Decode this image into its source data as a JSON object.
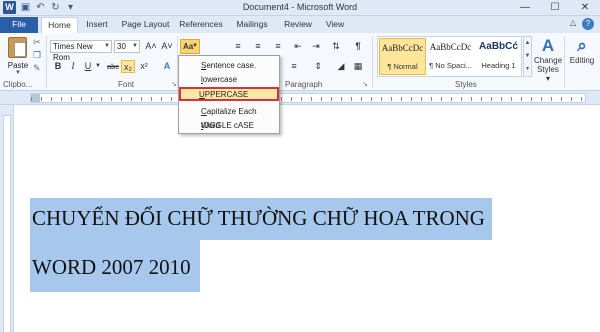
{
  "window": {
    "title": "Document4 - Microsoft Word",
    "app_icon": "W"
  },
  "qat": {
    "save": "💾",
    "undo": "↶",
    "redo": "↻",
    "more": "▾"
  },
  "winbtns": {
    "minimize": "—",
    "maximize": "☐",
    "close": "✕"
  },
  "tabs": [
    "File",
    "Home",
    "Insert",
    "Page Layout",
    "References",
    "Mailings",
    "Review",
    "View"
  ],
  "tab_help": "?",
  "ribbon": {
    "clipboard": {
      "paste": "Paste",
      "label": "Clipbo..."
    },
    "font": {
      "name": "Times New Rom",
      "size": "30",
      "grow": "A˄",
      "shrink": "A˅",
      "change_case": "Aa",
      "bold": "B",
      "italic": "I",
      "underline": "U",
      "strike": "abc",
      "subscript": "x₂",
      "superscript": "x²",
      "label": "Font"
    },
    "paragraph": {
      "label": "Paragraph"
    },
    "styles": {
      "items": [
        {
          "sample": "AaBbCcDc",
          "name": "¶ Normal"
        },
        {
          "sample": "AaBbCcDc",
          "name": "¶ No Spaci..."
        },
        {
          "sample": "AaBbCć",
          "name": "Heading 1"
        }
      ],
      "label": "Styles",
      "change_styles": "Change Styles ▾",
      "change_styles_icon": "A"
    },
    "editing": {
      "label": "Editing",
      "icon": "⌕"
    }
  },
  "case_menu": [
    {
      "label": "Sentence case.",
      "accel": "S"
    },
    {
      "label": "lowercase",
      "accel": "l"
    },
    {
      "label": "UPPERCASE",
      "accel": "U",
      "highlighted": true
    },
    {
      "label": "Capitalize Each Word",
      "accel": "C"
    },
    {
      "label": "tOGGLE cASE",
      "accel": "t"
    }
  ],
  "document": {
    "line1": "CHUYỂN ĐỔI CHỮ THƯỜNG CHỮ HOA TRONG",
    "line2": "WORD 2007 2010"
  },
  "colors": {
    "selection": "#a7c8ec",
    "file_tab": "#2a5fa8",
    "menu_highlight_border": "#d9323c"
  }
}
